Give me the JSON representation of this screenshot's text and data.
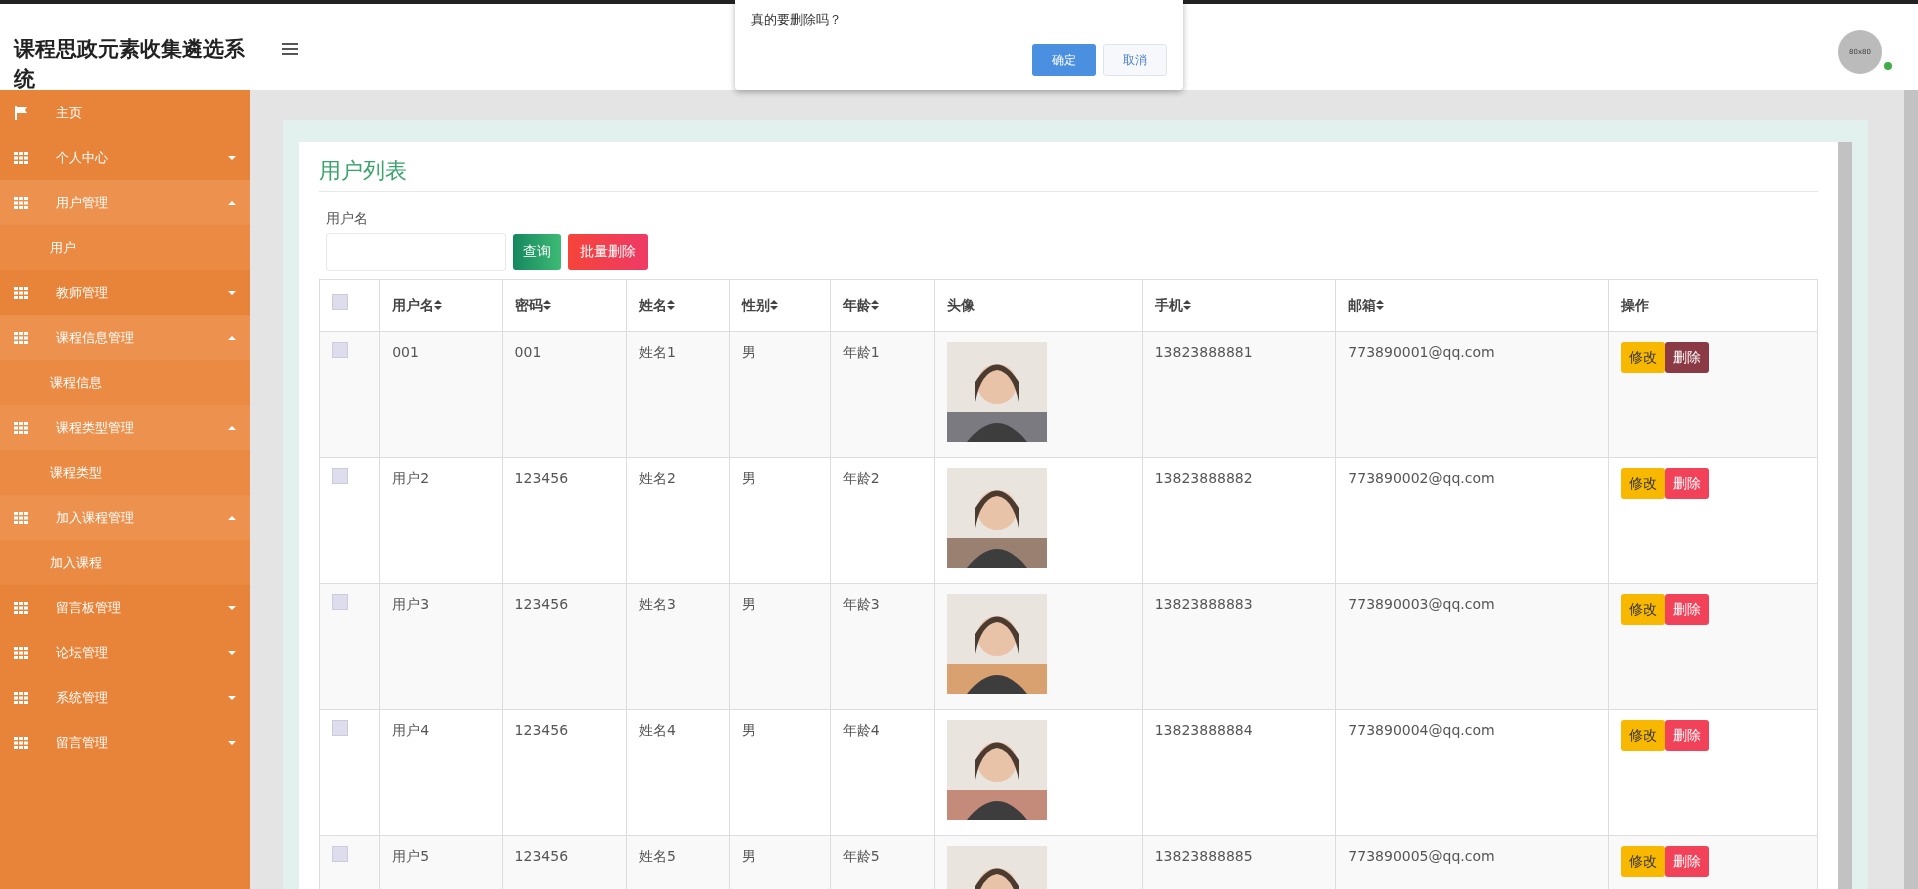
{
  "header": {
    "title": "课程思政元素收集遴选系统",
    "avatar_text": "80x80",
    "online": true
  },
  "dialog": {
    "message": "真的要删除吗？",
    "buttons": [
      {
        "label": "确定",
        "kind": "primary"
      },
      {
        "label": "取消",
        "kind": "secondary"
      }
    ]
  },
  "sidebar": {
    "items": [
      {
        "label": "主页",
        "kind": "link"
      },
      {
        "label": "个人中心",
        "kind": "group",
        "expanded": false
      },
      {
        "label": "用户管理",
        "kind": "group",
        "expanded": true,
        "children": [
          {
            "label": "用户"
          }
        ]
      },
      {
        "label": "教师管理",
        "kind": "group",
        "expanded": false
      },
      {
        "label": "课程信息管理",
        "kind": "group",
        "expanded": true,
        "children": [
          {
            "label": "课程信息"
          }
        ]
      },
      {
        "label": "课程类型管理",
        "kind": "group",
        "expanded": true,
        "children": [
          {
            "label": "课程类型"
          }
        ]
      },
      {
        "label": "加入课程管理",
        "kind": "group",
        "expanded": true,
        "children": [
          {
            "label": "加入课程"
          }
        ]
      },
      {
        "label": "留言板管理",
        "kind": "group",
        "expanded": false
      },
      {
        "label": "论坛管理",
        "kind": "group",
        "expanded": false
      },
      {
        "label": "系统管理",
        "kind": "group",
        "expanded": false
      },
      {
        "label": "留言管理",
        "kind": "group",
        "expanded": false
      }
    ]
  },
  "panel": {
    "title": "用户列表",
    "search": {
      "label": "用户名"
    },
    "buttons": [
      {
        "label": "查询",
        "kind": "search"
      },
      {
        "label": "批量删除",
        "kind": "danger"
      }
    ]
  },
  "table": {
    "select_all_checked": false,
    "columns": [
      {
        "label": "用户名",
        "sortable": true
      },
      {
        "label": "密码",
        "sortable": true
      },
      {
        "label": "姓名",
        "sortable": true
      },
      {
        "label": "性别",
        "sortable": true
      },
      {
        "label": "年龄",
        "sortable": true
      },
      {
        "label": "头像",
        "sortable": false
      },
      {
        "label": "手机",
        "sortable": true
      },
      {
        "label": "邮箱",
        "sortable": true
      },
      {
        "label": "操作",
        "sortable": false
      }
    ],
    "rows": [
      {
        "checked": false,
        "cells": [
          "001",
          "001",
          "姓名1",
          "男",
          "年龄1"
        ],
        "phone": "13823888881",
        "email": "773890001@qq.com",
        "edit": "修改",
        "delete": "删除",
        "delete_hovered": true
      },
      {
        "checked": false,
        "cells": [
          "用户2",
          "123456",
          "姓名2",
          "男",
          "年龄2"
        ],
        "phone": "13823888882",
        "email": "773890002@qq.com",
        "edit": "修改",
        "delete": "删除",
        "delete_hovered": false
      },
      {
        "checked": false,
        "cells": [
          "用户3",
          "123456",
          "姓名3",
          "男",
          "年龄3"
        ],
        "phone": "13823888883",
        "email": "773890003@qq.com",
        "edit": "修改",
        "delete": "删除",
        "delete_hovered": false
      },
      {
        "checked": false,
        "cells": [
          "用户4",
          "123456",
          "姓名4",
          "男",
          "年龄4"
        ],
        "phone": "13823888884",
        "email": "773890004@qq.com",
        "edit": "修改",
        "delete": "删除",
        "delete_hovered": false
      },
      {
        "checked": false,
        "cells": [
          "用户5",
          "123456",
          "姓名5",
          "男",
          "年龄5"
        ],
        "phone": "13823888885",
        "email": "773890005@qq.com",
        "edit": "修改",
        "delete": "删除",
        "delete_hovered": false
      }
    ]
  }
}
